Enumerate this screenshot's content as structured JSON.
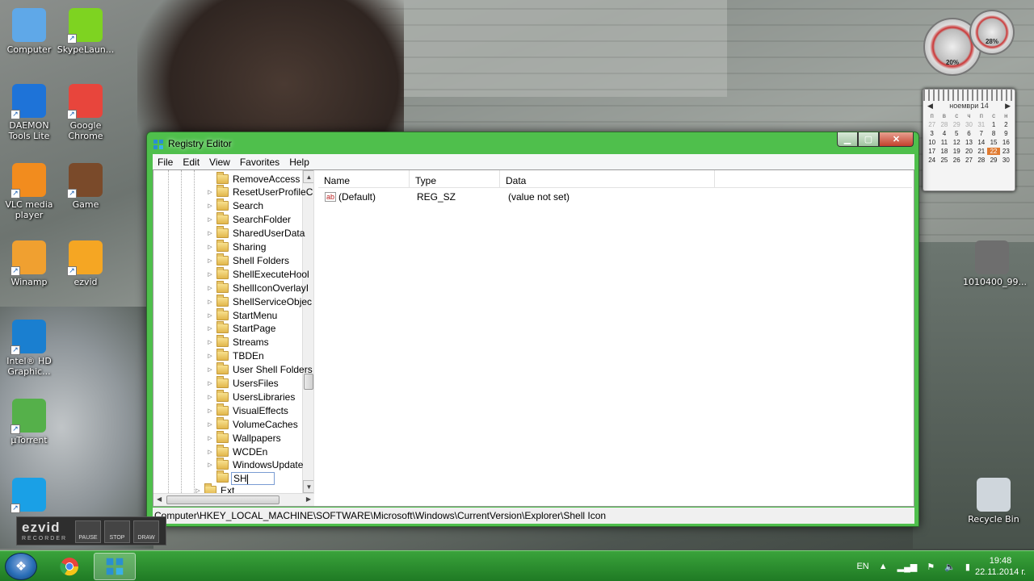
{
  "desktop": {
    "icons": [
      {
        "label": "Computer",
        "icon": "computer-icon",
        "color": "#5fa8e8"
      },
      {
        "label": "SkypeLaun...",
        "icon": "skype-launcher-icon",
        "color": "#7ed321"
      },
      {
        "label": "DAEMON Tools Lite",
        "icon": "daemon-tools-icon",
        "color": "#1e73d8"
      },
      {
        "label": "Google Chrome",
        "icon": "chrome-icon",
        "color": "#e8453c"
      },
      {
        "label": "VLC media player",
        "icon": "vlc-icon",
        "color": "#f28c1e"
      },
      {
        "label": "Game",
        "icon": "game-icon",
        "color": "#7a4a2a"
      },
      {
        "label": "Winamp",
        "icon": "winamp-icon",
        "color": "#f0a030"
      },
      {
        "label": "ezvid",
        "icon": "ezvid-icon",
        "color": "#f5a623"
      },
      {
        "label": "Intel® HD Graphic...",
        "icon": "intel-graphics-icon",
        "color": "#1a7fd0"
      },
      {
        "label": "µTorrent",
        "icon": "utorrent-icon",
        "color": "#55b04a"
      },
      {
        "label": "",
        "icon": "skype-icon",
        "color": "#1aa0e6"
      },
      {
        "label": "1010400_99...",
        "icon": "image-file-icon",
        "color": "#6e6e6e"
      },
      {
        "label": "Recycle Bin",
        "icon": "recycle-bin-icon",
        "color": "#cfd6dc"
      }
    ]
  },
  "gadgets": {
    "cpu_gauge": "20%",
    "mem_gauge": "28%",
    "calendar": {
      "month": "ноември 14",
      "weekdays": [
        "п",
        "в",
        "с",
        "ч",
        "п",
        "с",
        "н"
      ],
      "weeks": [
        [
          "27",
          "28",
          "29",
          "30",
          "31",
          "1",
          "2"
        ],
        [
          "3",
          "4",
          "5",
          "6",
          "7",
          "8",
          "9"
        ],
        [
          "10",
          "11",
          "12",
          "13",
          "14",
          "15",
          "16"
        ],
        [
          "17",
          "18",
          "19",
          "20",
          "21",
          "22",
          "23"
        ],
        [
          "24",
          "25",
          "26",
          "27",
          "28",
          "29",
          "30"
        ]
      ],
      "today": "22"
    }
  },
  "window": {
    "title": "Registry Editor",
    "menu": [
      "File",
      "Edit",
      "View",
      "Favorites",
      "Help"
    ],
    "tree": {
      "items": [
        "RemoveAccess",
        "ResetUserProfileC",
        "Search",
        "SearchFolder",
        "SharedUserData",
        "Sharing",
        "Shell Folders",
        "ShellExecuteHool",
        "ShellIconOverlayI",
        "ShellServiceObjec",
        "StartMenu",
        "StartPage",
        "Streams",
        "TBDEn",
        "User Shell Folders",
        "UsersFiles",
        "UsersLibraries",
        "VisualEffects",
        "VolumeCaches",
        "Wallpapers",
        "WCDEn",
        "WindowsUpdate"
      ],
      "editing_value": "SH",
      "partial_item": "Ext"
    },
    "columns": [
      "Name",
      "Type",
      "Data"
    ],
    "rows": [
      {
        "name": "(Default)",
        "type": "REG_SZ",
        "data": "(value not set)"
      }
    ],
    "status_path": "Computer\\HKEY_LOCAL_MACHINE\\SOFTWARE\\Microsoft\\Windows\\CurrentVersion\\Explorer\\Shell Icon",
    "frame_color": "#4fbf4c"
  },
  "ezvid_recorder": {
    "logo": "ezvid",
    "sub": "RECORDER",
    "buttons": [
      "PAUSE",
      "STOP",
      "DRAW"
    ]
  },
  "taskbar": {
    "language": "EN",
    "time": "19:48",
    "date": "22.11.2014 г.",
    "apps": [
      "chrome-icon",
      "registry-editor-icon"
    ]
  }
}
